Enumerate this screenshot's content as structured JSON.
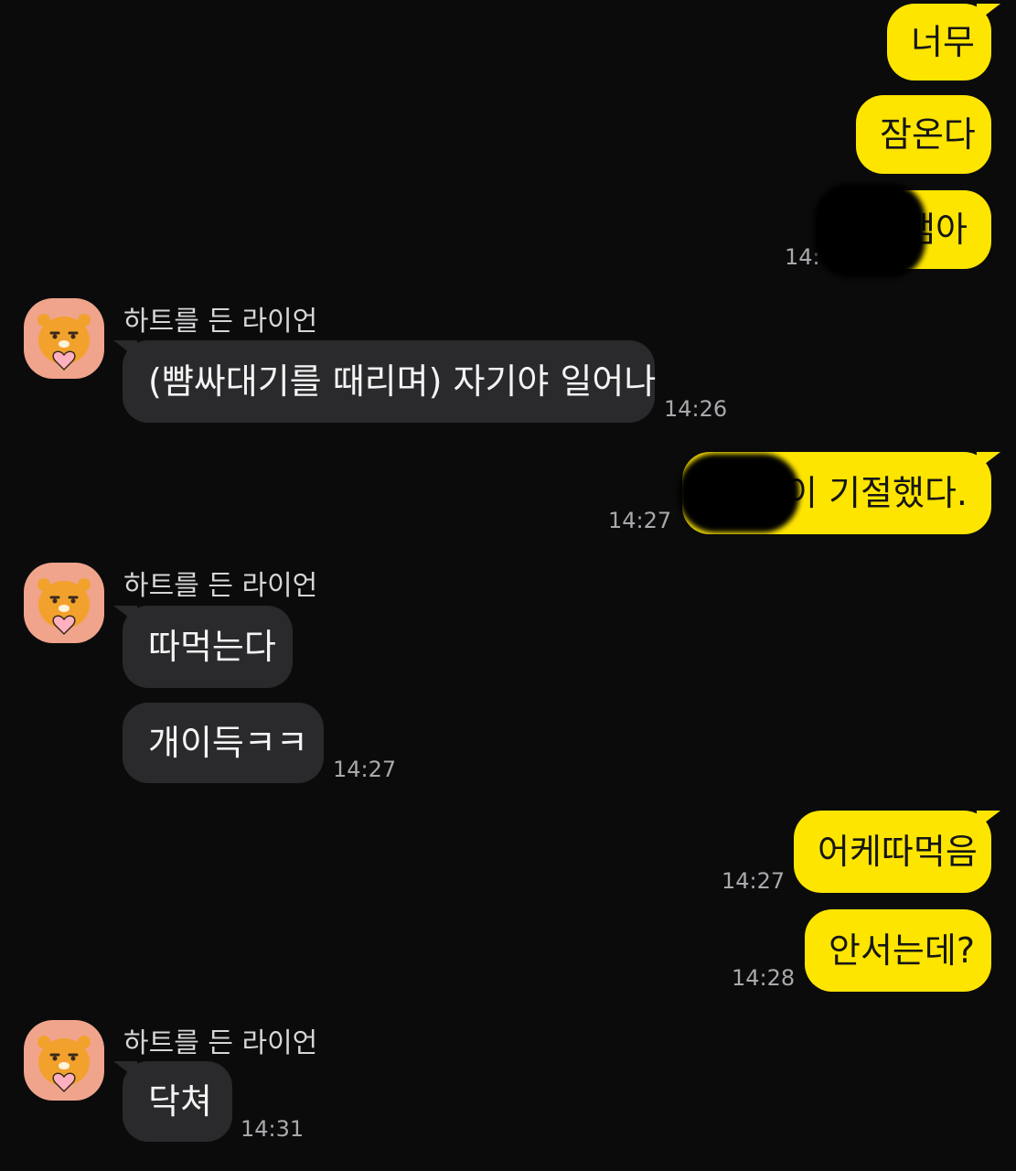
{
  "messages": {
    "m1": {
      "text": "너무"
    },
    "m2": {
      "text": "잠온다"
    },
    "m3": {
      "text": "잼아",
      "time": "14:"
    },
    "r1": {
      "sender": "하트를 든 라이언",
      "text": "(뺨싸대기를 때리며) 자기야 일어나",
      "time": "14:26"
    },
    "m4": {
      "text": "이 기절했다.",
      "time": "14:27"
    },
    "r2": {
      "sender": "하트를 든 라이언",
      "text1": "따먹는다",
      "text2": "개이득ㅋㅋ",
      "time": "14:27"
    },
    "m5": {
      "text": "어케따먹음",
      "time": "14:27"
    },
    "m6": {
      "text": "안서는데?",
      "time": "14:28"
    },
    "r3": {
      "sender": "하트를 든 라이언",
      "text": "닥쳐",
      "time": "14:31"
    }
  },
  "colors": {
    "background": "#0b0b0c",
    "my_bubble": "#fee500",
    "their_bubble": "#2a2a2d",
    "avatar_bg": "#f0a48c"
  },
  "icons": {
    "avatar": "ryan-holding-heart-icon"
  }
}
